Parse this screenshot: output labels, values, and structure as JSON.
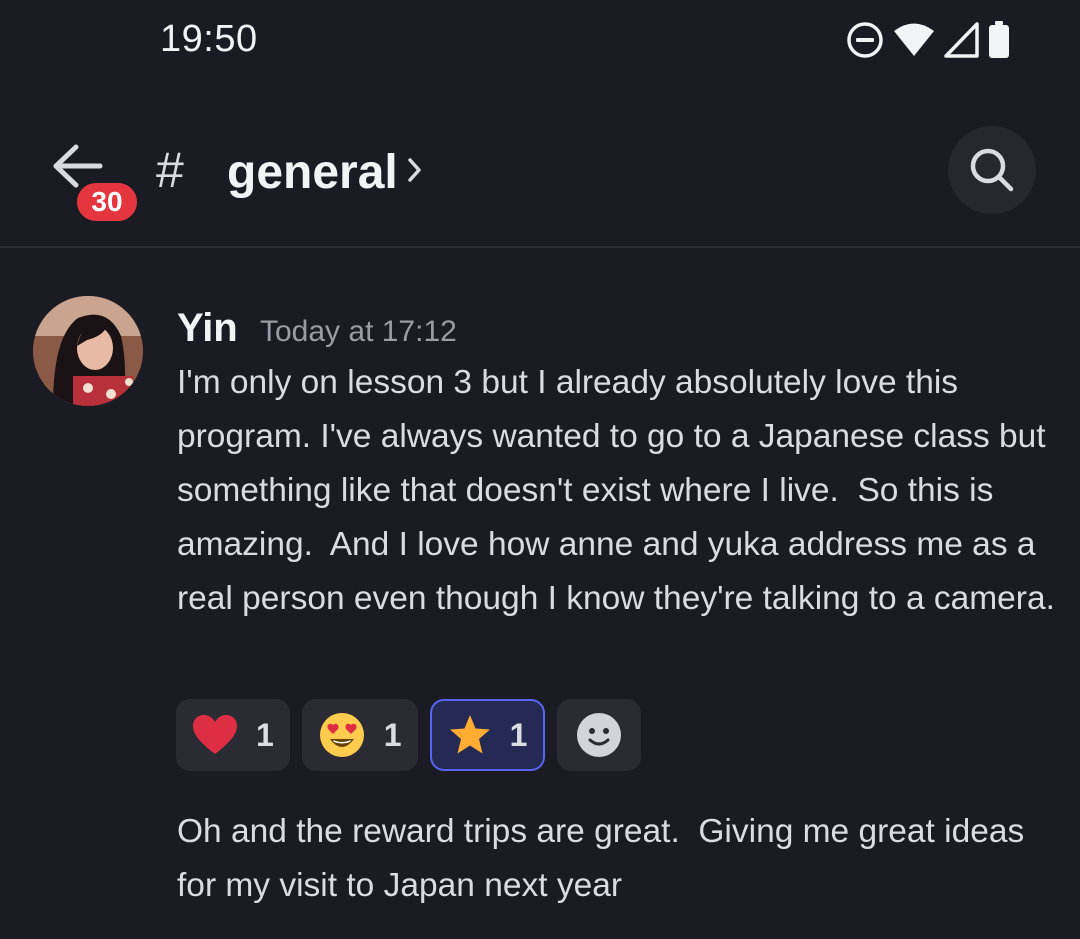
{
  "status_bar": {
    "time": "19:50",
    "icons": [
      "do-not-disturb-icon",
      "wifi-icon",
      "signal-icon",
      "battery-icon"
    ]
  },
  "header": {
    "back_icon": "arrow-left-icon",
    "unread_count": "30",
    "hash_symbol": "#",
    "channel_name": "general",
    "chevron_icon": "chevron-right-icon",
    "search_icon": "search-icon"
  },
  "message": {
    "author": "Yin",
    "timestamp": "Today at 17:12",
    "text": "I'm only on lesson 3 but I already absolutely love this program. I've always wanted to go to a Japanese class but something like that doesn't exist where I live.  So this is amazing.  And I love how anne and yuka address me as a real person even though I know they're talking to a camera.",
    "reactions": [
      {
        "emoji": "red-heart",
        "count": "1",
        "active": false
      },
      {
        "emoji": "heart-eyes-face",
        "count": "1",
        "active": false
      },
      {
        "emoji": "star",
        "count": "1",
        "active": true
      }
    ],
    "add_reaction_icon": "add-reaction-icon"
  },
  "followup": {
    "text": "Oh and the reward trips are great.  Giving me great ideas for my visit to Japan next year"
  },
  "colors": {
    "background": "#1b1c23",
    "badge": "#e5363f",
    "active_reaction_border": "#5865f2",
    "active_reaction_bg": "#252a55"
  }
}
